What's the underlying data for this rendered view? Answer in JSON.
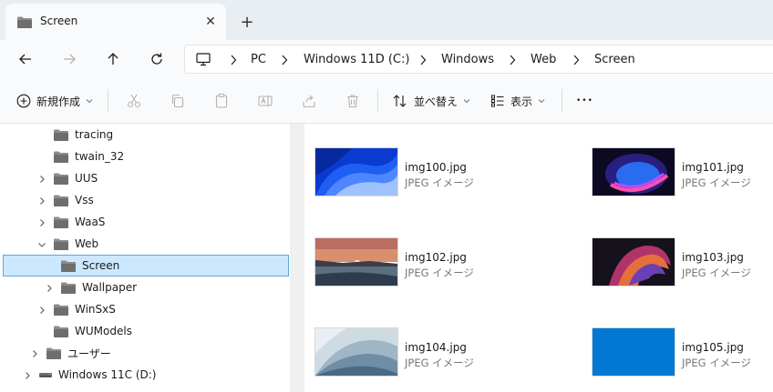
{
  "tab": {
    "title": "Screen",
    "close_glyph": "✕",
    "new_tab_glyph": "+"
  },
  "nav": {
    "back_icon": "arrow-left-icon",
    "forward_icon": "arrow-right-icon",
    "up_icon": "arrow-up-icon",
    "refresh_icon": "refresh-icon"
  },
  "breadcrumb": [
    "PC",
    "Windows 11D (C:)",
    "Windows",
    "Web",
    "Screen"
  ],
  "commands": {
    "new_label": "新規作成",
    "sort_label": "並べ替え",
    "view_label": "表示",
    "more_glyph": "•••"
  },
  "tree": [
    {
      "label": "tracing",
      "expandable": false
    },
    {
      "label": "twain_32",
      "expandable": false
    },
    {
      "label": "UUS",
      "expandable": true
    },
    {
      "label": "Vss",
      "expandable": true
    },
    {
      "label": "WaaS",
      "expandable": true
    },
    {
      "label": "Web",
      "expandable": true,
      "expanded": true
    },
    {
      "label": "Screen",
      "expandable": false,
      "selected": true
    },
    {
      "label": "Wallpaper",
      "expandable": true
    },
    {
      "label": "WinSxS",
      "expandable": true
    },
    {
      "label": "WUModels",
      "expandable": false
    },
    {
      "label": "ユーザー",
      "expandable": true
    },
    {
      "label": "Windows 11C (D:)",
      "expandable": true,
      "drive": true
    }
  ],
  "files": [
    {
      "name": "img100.jpg",
      "type": "JPEG イメージ"
    },
    {
      "name": "img101.jpg",
      "type": "JPEG イメージ"
    },
    {
      "name": "img102.jpg",
      "type": "JPEG イメージ"
    },
    {
      "name": "img103.jpg",
      "type": "JPEG イメージ"
    },
    {
      "name": "img104.jpg",
      "type": "JPEG イメージ"
    },
    {
      "name": "img105.jpg",
      "type": "JPEG イメージ"
    }
  ],
  "colors": {
    "accent": "#0078d4",
    "folder": "#7a7a7a",
    "selection": "#cce8ff",
    "selection_border": "#5ea8d8"
  }
}
